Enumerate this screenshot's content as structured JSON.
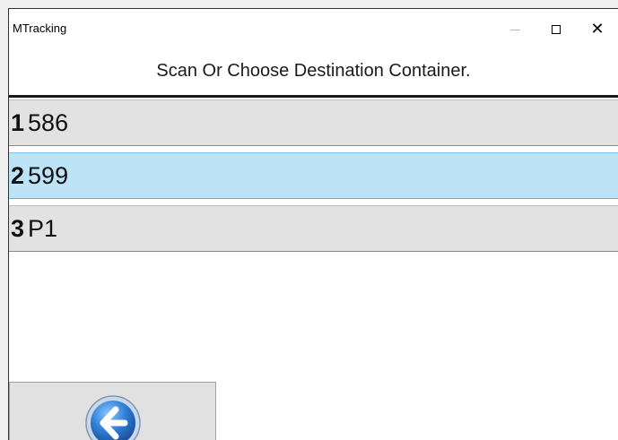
{
  "window": {
    "title": "MTracking"
  },
  "header": {
    "prompt": "Scan Or Choose Destination Container."
  },
  "containers": [
    {
      "number": "1",
      "name": "586",
      "selected": false
    },
    {
      "number": "2",
      "name": "599",
      "selected": true
    },
    {
      "number": "3",
      "name": "P1",
      "selected": false
    }
  ],
  "footer": {
    "back_icon": "back-arrow-icon"
  },
  "colors": {
    "selected_row": "#bde3f7",
    "row": "#e2e2e2",
    "back_icon": "#2f7fd6"
  }
}
